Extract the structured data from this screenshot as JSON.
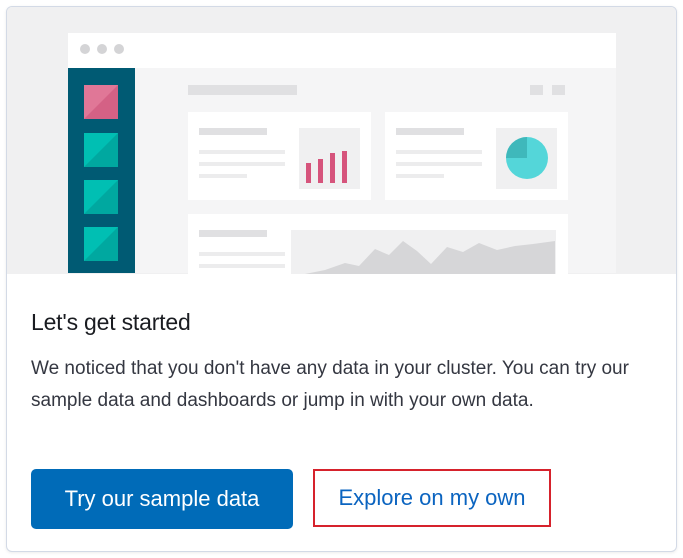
{
  "card": {
    "title": "Let's get started",
    "description": "We noticed that you don't have any data in your cluster. You can try our sample data and dashboards or jump in with your own data.",
    "primary_button_label": "Try our sample data",
    "secondary_link_label": "Explore on my own"
  },
  "illustration": {
    "sidebar_color": "#005a73",
    "accent_pink": "#e07797",
    "accent_teal": "#00bfb3",
    "pie_color": "#54d6d9",
    "bar_color": "#d6547c"
  },
  "colors": {
    "primary": "#006bb8",
    "link": "#0b64c0",
    "highlight_border": "#d6222c"
  }
}
